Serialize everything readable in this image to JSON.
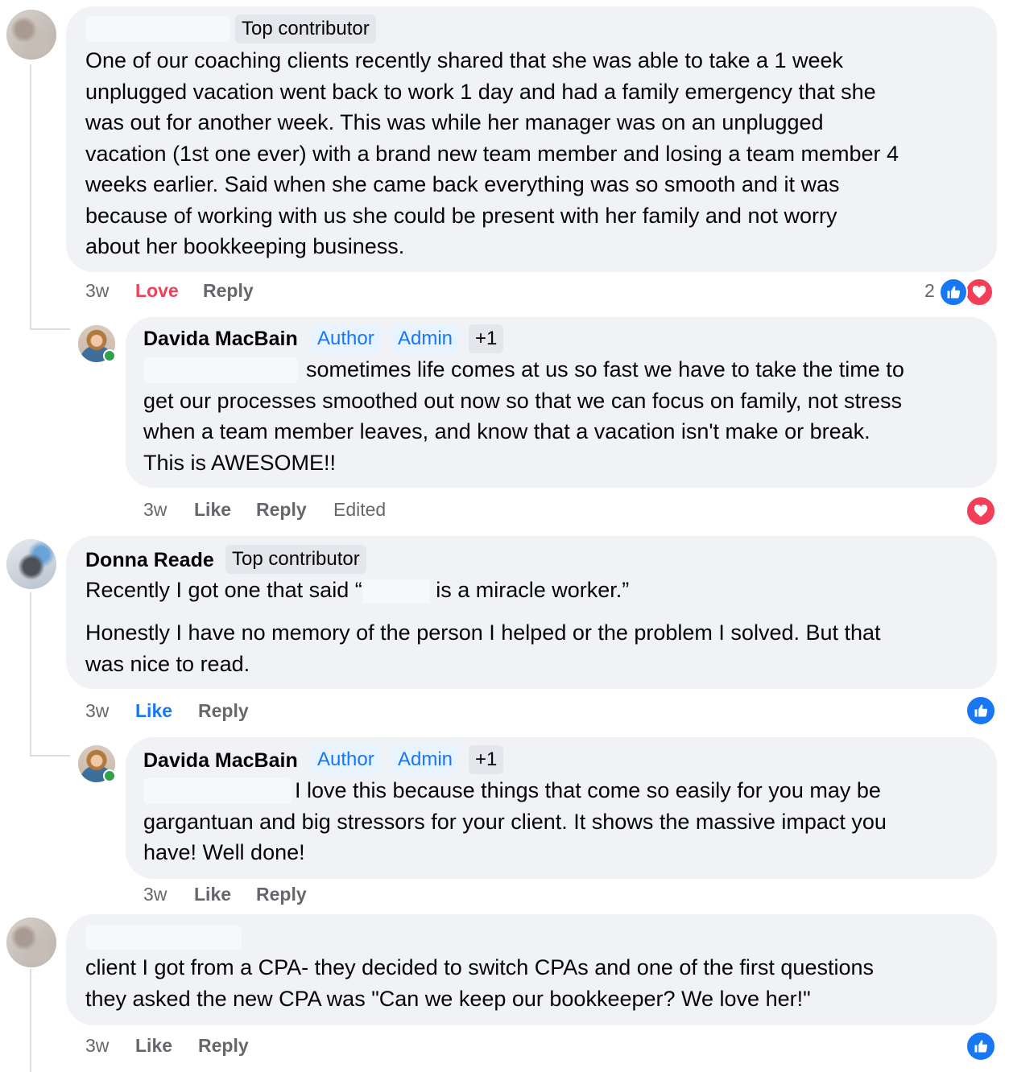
{
  "comments": [
    {
      "author_hidden": true,
      "badge": "Top contributor",
      "text_lines": [
        "One of our coaching clients recently shared that she was able to take a 1 week",
        "unplugged vacation went back to work 1 day and had a family emergency that she",
        "was out for another week. This was while her manager was on an unplugged",
        "vacation (1st one ever) with a brand new team member and losing a team member 4",
        "weeks earlier. Said when she came back everything was so smooth and it was",
        "because of working with us she could be present with her family and not worry",
        "about her bookkeeping business."
      ],
      "time": "3w",
      "reaction_label": "Love",
      "reply_label": "Reply",
      "reaction_count": "2"
    },
    {
      "author": "Davida MacBain",
      "badges": [
        "Author",
        "Admin",
        "+1"
      ],
      "text_lines": [
        "sometimes life comes at us so fast we have to take the time to",
        "get our processes smoothed out now so that we can focus on family, not stress",
        "when a team member leaves, and know that a vacation isn't make or break.",
        "This is AWESOME!!"
      ],
      "time": "3w",
      "like_label": "Like",
      "reply_label": "Reply",
      "edited_label": "Edited"
    },
    {
      "author": "Donna Reade",
      "badge": "Top contributor",
      "line1_start": "Recently I got one that said “",
      "line1_end": "is a miracle worker.”",
      "text_lines": [
        "Honestly I have no memory of the person I helped or the problem I solved. But that",
        "was nice to read."
      ],
      "time": "3w",
      "like_label": "Like",
      "reply_label": "Reply"
    },
    {
      "author": "Davida MacBain",
      "badges": [
        "Author",
        "Admin",
        "+1"
      ],
      "text_lines": [
        "I love this because things that come so easily for you may be",
        "gargantuan and big stressors for your client. It shows the massive impact you",
        "have! Well done!"
      ],
      "time": "3w",
      "like_label": "Like",
      "reply_label": "Reply"
    },
    {
      "author_hidden": true,
      "text_lines": [
        "client I got from a CPA- they decided to switch CPAs and one of the first questions",
        "they asked the new CPA was \"Can we keep our bookkeeper? We love her!\""
      ],
      "time": "3w",
      "like_label": "Like",
      "reply_label": "Reply"
    }
  ],
  "icons": {
    "like": "thumbs-up-icon",
    "love": "heart-icon"
  },
  "colors": {
    "bubble": "#f0f2f5",
    "link_blue": "#1877f2",
    "love_red": "#f33e58",
    "meta_gray": "#65676b"
  }
}
